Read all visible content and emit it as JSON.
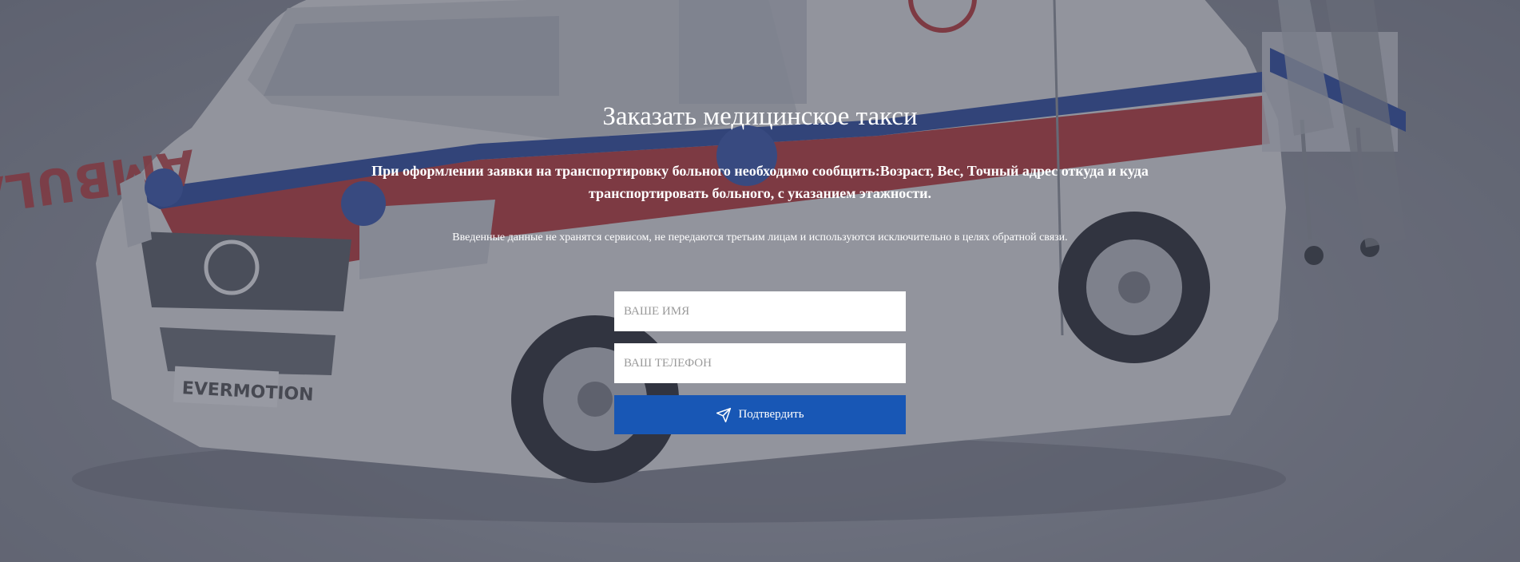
{
  "page": {
    "title": "Заказать медицинское такси",
    "subtitle": "При оформлении заявки на транспортировку больного необходимо сообщить:Возраст, Вес, Точный адрес откуда и куда транспортировать больного, с указанием этажности.",
    "privacy_note": "Введенные данные не хранятся сервисом, не передаются третьим лицам и используются исключительно в целях обратной связи."
  },
  "form": {
    "name_placeholder": "ВАШЕ ИМЯ",
    "phone_placeholder": "ВАШ ТЕЛЕФОН",
    "submit_label": "Подтвердить",
    "submit_icon": "paper-plane-icon"
  },
  "background": {
    "ambulance_text": "AMBULANCE",
    "plate_text": "EVERMOTION"
  },
  "colors": {
    "button": "#1857b5",
    "overlay": "rgba(55,60,80,0.45)",
    "text": "#ffffff"
  }
}
